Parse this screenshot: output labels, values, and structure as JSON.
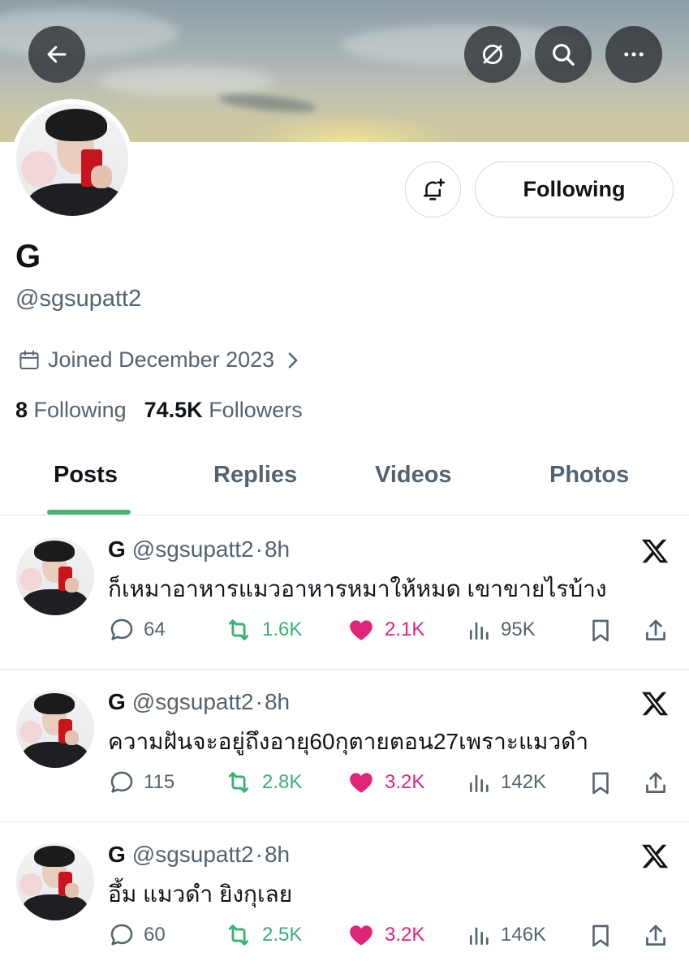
{
  "header": {
    "back_icon": "back-arrow-icon",
    "grok_icon": "grok-icon",
    "search_icon": "search-icon",
    "more_icon": "more-icon"
  },
  "profile": {
    "name": "G",
    "handle": "@sgsupatt2",
    "joined": "Joined December 2023",
    "following_count": "8",
    "following_label": "Following",
    "followers_count": "74.5K",
    "followers_label": "Followers",
    "follow_button": "Following"
  },
  "tabs": [
    {
      "label": "Posts",
      "active": true
    },
    {
      "label": "Replies",
      "active": false
    },
    {
      "label": "Videos",
      "active": false
    },
    {
      "label": "Photos",
      "active": false
    }
  ],
  "posts": [
    {
      "name": "G",
      "handle": "@sgsupatt2",
      "sep": "·",
      "time": "8h",
      "text": "ก็เหมาอาหารแมวอาหารหมาให้หมด เขาขายไรบ้าง",
      "replies": "64",
      "reposts": "1.6K",
      "likes": "2.1K",
      "views": "95K"
    },
    {
      "name": "G",
      "handle": "@sgsupatt2",
      "sep": "·",
      "time": "8h",
      "text": "ความฝันจะอยู่ถึงอายุ60กุตายตอน27เพราะแมวดำ",
      "replies": "115",
      "reposts": "2.8K",
      "likes": "3.2K",
      "views": "142K"
    },
    {
      "name": "G",
      "handle": "@sgsupatt2",
      "sep": "·",
      "time": "8h",
      "text": "อึ้ม แมวดำ ยิงกุเลย",
      "replies": "60",
      "reposts": "2.5K",
      "likes": "3.2K",
      "views": "146K"
    }
  ],
  "colors": {
    "accent_tab": "#45b477",
    "repost": "#3ab075",
    "like": "#e0247a",
    "secondary_text": "#536471"
  }
}
